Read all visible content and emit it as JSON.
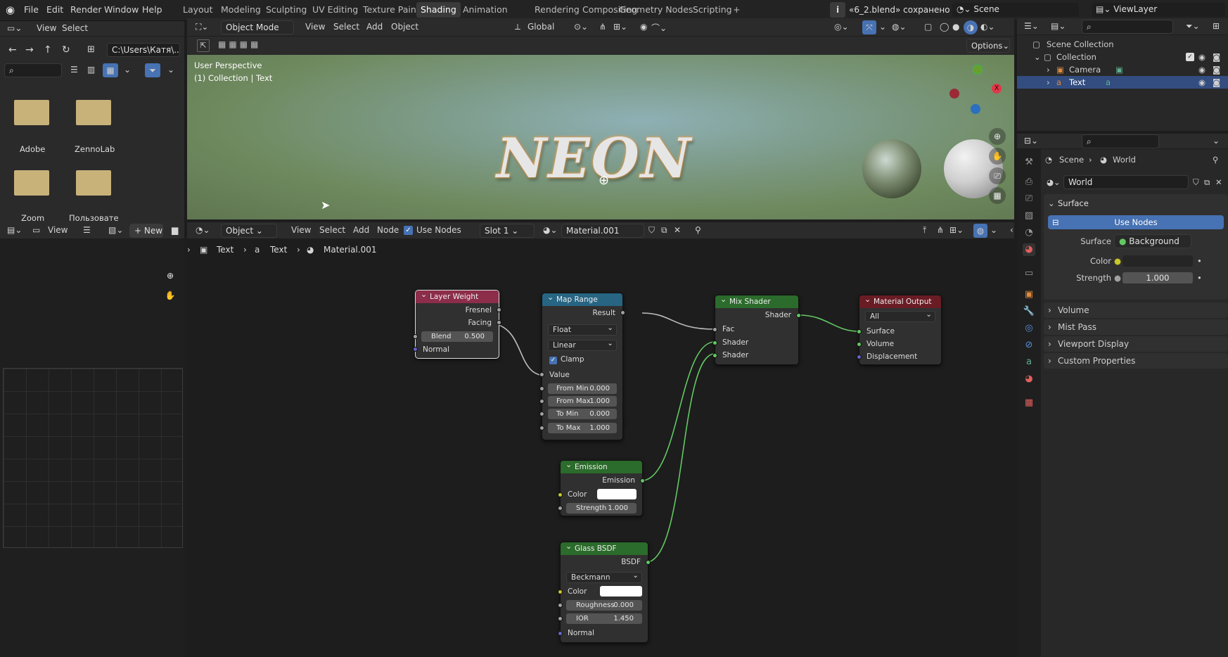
{
  "menu": {
    "file": "File",
    "edit": "Edit",
    "render": "Render",
    "window": "Window",
    "help": "Help"
  },
  "workspaces": [
    "Layout",
    "Modeling",
    "Sculpting",
    "UV Editing",
    "Texture Paint",
    "Shading",
    "Animation",
    "Rendering",
    "Compositing",
    "Geometry Nodes",
    "Scripting"
  ],
  "active_workspace": "Shading",
  "status_saved": "«6_2.blend» сохранено",
  "scene_name": "Scene",
  "view_layer": "ViewLayer",
  "file_browser": {
    "view": "View",
    "select": "Select",
    "path": "C:\\Users\\Катя\\...",
    "folders": [
      "Adobe",
      "ZennoLab",
      "Zoom",
      "Пользовате"
    ]
  },
  "viewport": {
    "mode": "Object Mode",
    "view": "View",
    "select": "Select",
    "add": "Add",
    "object": "Object",
    "orientation": "Global",
    "options": "Options",
    "perspective": "User Perspective",
    "collection_info": "(1) Collection | Text",
    "text3d": "NEON"
  },
  "image_editor": {
    "view": "View",
    "new": "New"
  },
  "node_editor": {
    "type": "Object",
    "view": "View",
    "select": "Select",
    "add": "Add",
    "node": "Node",
    "use_nodes": "Use Nodes",
    "slot": "Slot 1",
    "material": "Material.001",
    "crumb1": "Text",
    "crumb2": "Text",
    "crumb3": "Material.001"
  },
  "nodes": {
    "layer_weight": {
      "title": "Layer Weight",
      "fresnel": "Fresnel",
      "facing": "Facing",
      "blend_label": "Blend",
      "blend_value": "0.500",
      "normal": "Normal"
    },
    "map_range": {
      "title": "Map Range",
      "result": "Result",
      "type": "Float",
      "interp": "Linear",
      "clamp": "Clamp",
      "value": "Value",
      "from_min_l": "From Min",
      "from_min": "0.000",
      "from_max_l": "From Max",
      "from_max": "1.000",
      "to_min_l": "To Min",
      "to_min": "0.000",
      "to_max_l": "To Max",
      "to_max": "1.000"
    },
    "mix_shader": {
      "title": "Mix Shader",
      "shader_out": "Shader",
      "fac": "Fac",
      "shader1": "Shader",
      "shader2": "Shader"
    },
    "material_output": {
      "title": "Material Output",
      "target": "All",
      "surface": "Surface",
      "volume": "Volume",
      "displacement": "Displacement"
    },
    "emission": {
      "title": "Emission",
      "out": "Emission",
      "color": "Color",
      "strength_l": "Strength",
      "strength": "1.000"
    },
    "glass": {
      "title": "Glass BSDF",
      "out": "BSDF",
      "dist": "Beckmann",
      "color": "Color",
      "rough_l": "Roughness",
      "rough": "0.000",
      "ior_l": "IOR",
      "ior": "1.450",
      "normal": "Normal"
    }
  },
  "outliner": {
    "scene_collection": "Scene Collection",
    "collection": "Collection",
    "camera": "Camera",
    "text": "Text"
  },
  "properties": {
    "crumb_scene": "Scene",
    "crumb_world": "World",
    "world_name": "World",
    "surface_panel": "Surface",
    "use_nodes": "Use Nodes",
    "surface_label": "Surface",
    "surface_value": "Background",
    "color_label": "Color",
    "strength_label": "Strength",
    "strength_value": "1.000",
    "volume": "Volume",
    "mist": "Mist Pass",
    "viewport_display": "Viewport Display",
    "custom_props": "Custom Properties"
  },
  "colors": {
    "accent": "#4772b3",
    "node_green": "#63c763",
    "layer_weight_header": "#8c2d4a",
    "map_range_header": "#276583",
    "shader_header": "#2b6b2b",
    "output_header": "#6a1c24"
  }
}
